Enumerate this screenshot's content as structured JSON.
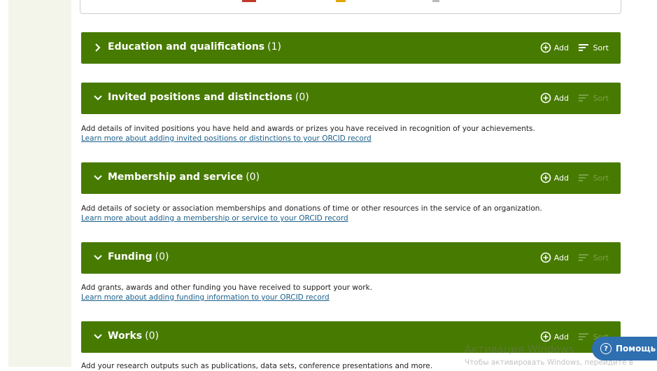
{
  "sections": [
    {
      "id": "education",
      "title": "Education and qualifications",
      "count": "(1)",
      "expanded": false,
      "add_label": "Add",
      "sort_label": "Sort",
      "sort_enabled": true
    },
    {
      "id": "invited",
      "title": "Invited positions and distinctions",
      "count": "(0)",
      "expanded": true,
      "add_label": "Add",
      "sort_label": "Sort",
      "sort_enabled": false,
      "description": "Add details of invited positions you have held and awards or prizes you have received in recognition of your achievements.",
      "link": "Learn more about adding invited positions or distinctions to your ORCID record"
    },
    {
      "id": "membership",
      "title": "Membership and service",
      "count": "(0)",
      "expanded": true,
      "add_label": "Add",
      "sort_label": "Sort",
      "sort_enabled": false,
      "description": "Add details of society or association memberships and donations of time or other resources in the service of an organization.",
      "link": "Learn more about adding a membership or service to your ORCID record"
    },
    {
      "id": "funding",
      "title": "Funding",
      "count": "(0)",
      "expanded": true,
      "add_label": "Add",
      "sort_label": "Sort",
      "sort_enabled": false,
      "description": "Add grants, awards and other funding you have received to support your work.",
      "link": "Learn more about adding funding information to your ORCID record"
    },
    {
      "id": "works",
      "title": "Works",
      "count": "(0)",
      "expanded": true,
      "add_label": "Add",
      "sort_label": "Sort",
      "sort_enabled": false,
      "description": "Add your research outputs such as publications, data sets, conference presentations and more."
    }
  ],
  "overlay": {
    "watermark_title": "Активация Windows",
    "watermark_sub": "Чтобы активировать Windows, перейдите в",
    "help_label": "Помощь"
  },
  "colors": {
    "section_bar": "#477a00",
    "link": "#1a5f8a",
    "help": "#2e6fb0"
  }
}
